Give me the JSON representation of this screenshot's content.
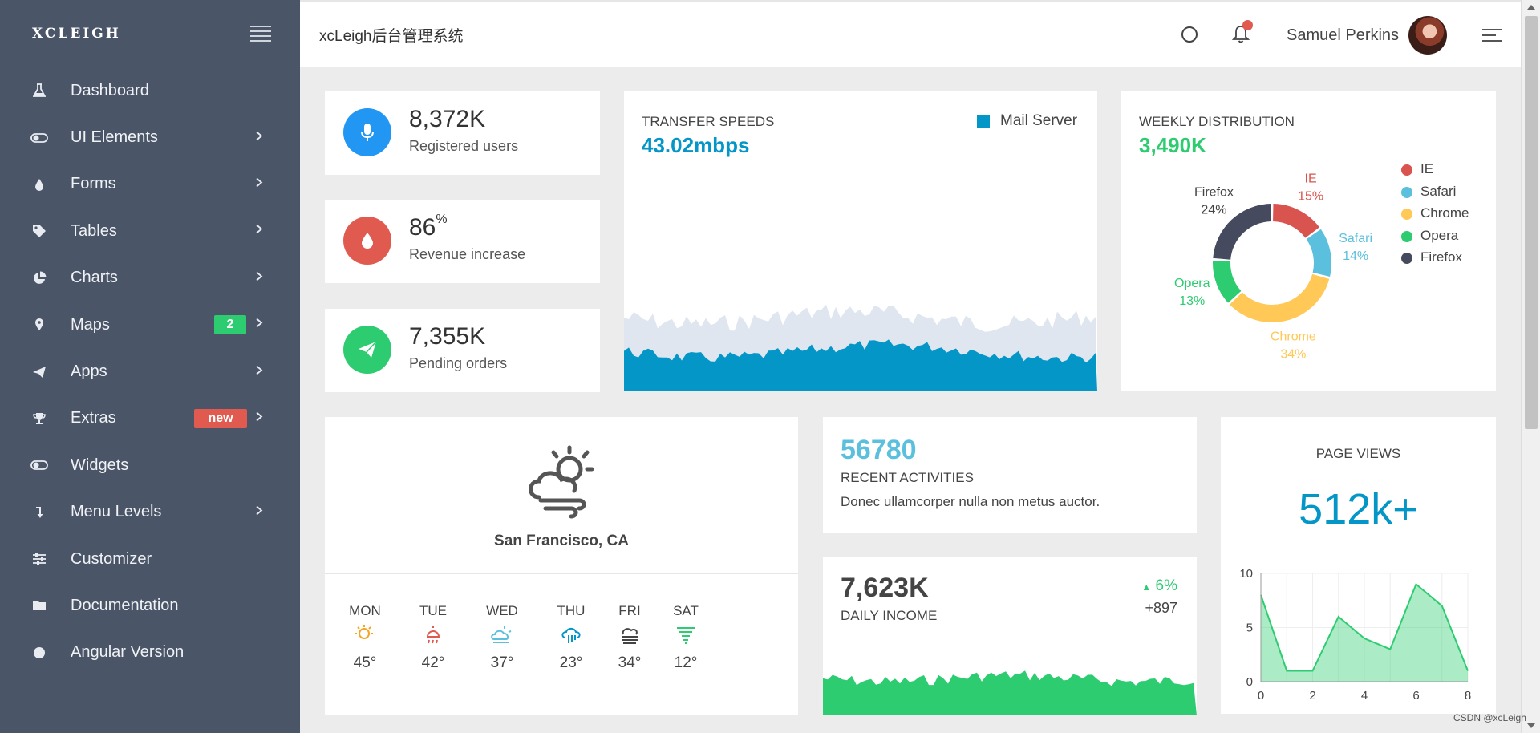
{
  "brand": "XCLEIGH",
  "header": {
    "title": "xcLeigh后台管理系统",
    "user_name": "Samuel Perkins"
  },
  "sidebar": {
    "items": [
      {
        "label": "Dashboard",
        "icon": "flask-icon"
      },
      {
        "label": "UI Elements",
        "icon": "toggle-icon",
        "chevron": true
      },
      {
        "label": "Forms",
        "icon": "drop-icon",
        "chevron": true
      },
      {
        "label": "Tables",
        "icon": "tag-icon",
        "chevron": true
      },
      {
        "label": "Charts",
        "icon": "pie-icon",
        "chevron": true
      },
      {
        "label": "Maps",
        "icon": "pin-icon",
        "chevron": true,
        "badge": "2"
      },
      {
        "label": "Apps",
        "icon": "send-icon",
        "chevron": true
      },
      {
        "label": "Extras",
        "icon": "trophy-icon",
        "chevron": true,
        "badge": "new"
      },
      {
        "label": "Widgets",
        "icon": "toggle-icon"
      },
      {
        "label": "Menu Levels",
        "icon": "arrow-down-icon",
        "chevron": true
      },
      {
        "label": "Customizer",
        "icon": "sliders-icon"
      },
      {
        "label": "Documentation",
        "icon": "folder-icon"
      },
      {
        "label": "Angular Version",
        "icon": "circle-icon"
      }
    ]
  },
  "stats": [
    {
      "value": "8,372K",
      "sup": "",
      "label": "Registered users",
      "color": "#2196f3",
      "icon": "microphone-icon"
    },
    {
      "value": "86",
      "sup": "%",
      "label": "Revenue increase",
      "color": "#e05a4f",
      "icon": "drop-icon"
    },
    {
      "value": "7,355K",
      "sup": "",
      "label": "Pending orders",
      "color": "#2ecc71",
      "icon": "send-icon"
    }
  ],
  "transfer": {
    "title": "TRANSFER SPEEDS",
    "value": "43.02mbps",
    "legend": "Mail Server",
    "color": "#0496c7"
  },
  "weekly": {
    "title": "WEEKLY DISTRIBUTION",
    "value": "3,490K",
    "color": "#2ecc71",
    "slices": [
      {
        "name": "IE",
        "percent": 15,
        "label": "15%",
        "color": "#d9534f"
      },
      {
        "name": "Safari",
        "percent": 14,
        "label": "14%",
        "color": "#5bc0de"
      },
      {
        "name": "Chrome",
        "percent": 34,
        "label": "34%",
        "color": "#ffc857"
      },
      {
        "name": "Opera",
        "percent": 13,
        "label": "13%",
        "color": "#2ecc71"
      },
      {
        "name": "Firefox",
        "percent": 24,
        "label": "24%",
        "color": "#454a5e"
      }
    ]
  },
  "weather": {
    "city": "San Francisco, CA",
    "days": [
      {
        "day": "MON",
        "temp": "45°",
        "icon": "sun-cloud-icon",
        "color": "#f5a623"
      },
      {
        "day": "TUE",
        "temp": "42°",
        "icon": "sun-rain-icon",
        "color": "#e05a4f"
      },
      {
        "day": "WED",
        "temp": "37°",
        "icon": "cloud-sun-icon",
        "color": "#5bc0de"
      },
      {
        "day": "THU",
        "temp": "23°",
        "icon": "cloud-rain-icon",
        "color": "#0496c7"
      },
      {
        "day": "FRI",
        "temp": "34°",
        "icon": "fog-icon",
        "color": "#444"
      },
      {
        "day": "SAT",
        "temp": "12°",
        "icon": "tornado-icon",
        "color": "#2ecc71"
      }
    ]
  },
  "activities": {
    "value": "56780",
    "title": "RECENT ACTIVITIES",
    "text": "Donec ullamcorper nulla non metus auctor.",
    "color": "#5bc0de"
  },
  "income": {
    "value": "7,623K",
    "title": "DAILY INCOME",
    "change": "6%",
    "delta": "+897",
    "color": "#2ecc71"
  },
  "pageviews": {
    "title": "PAGE VIEWS",
    "value": "512k+",
    "color": "#0496c7"
  },
  "chart_data": {
    "type": "area",
    "x": [
      0,
      1,
      2,
      3,
      4,
      5,
      6,
      7,
      8
    ],
    "values": [
      8,
      1,
      1,
      6,
      4,
      3,
      9,
      7,
      1
    ],
    "x_ticks": [
      "0",
      "2",
      "4",
      "6",
      "8"
    ],
    "y_ticks": [
      "0",
      "5",
      "10"
    ],
    "xlim": [
      0,
      8
    ],
    "ylim": [
      0,
      10
    ],
    "grid": true,
    "color": "#2ecc71"
  },
  "footer_note": "CSDN @xcLeigh"
}
